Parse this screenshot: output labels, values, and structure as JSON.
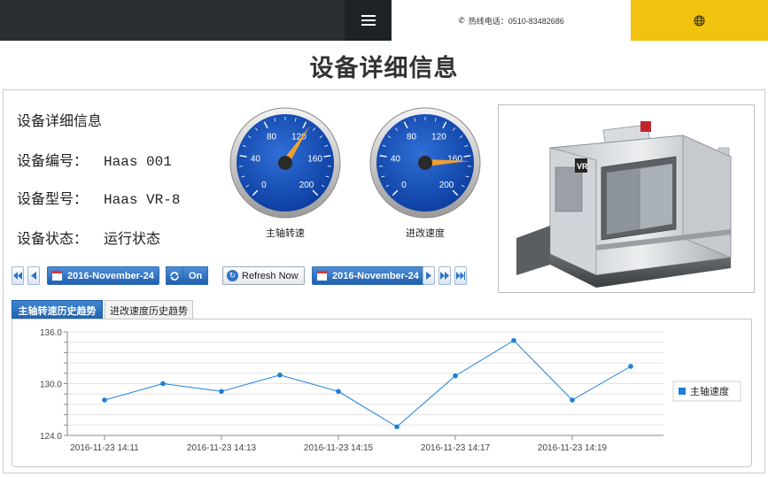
{
  "header": {
    "hotline_text": "热线电话：0510-83482686",
    "menu_icon": "hamburger-menu-icon",
    "phone_icon": "phone-icon",
    "globe_icon": "globe-icon",
    "accent_color": "#f1c30f"
  },
  "page": {
    "title": "设备详细信息"
  },
  "device": {
    "heading": "设备详细信息",
    "number_label": "设备编号：",
    "number_value": "Haas 001",
    "model_label": "设备型号：",
    "model_value": "Haas VR-8",
    "status_label": "设备状态：",
    "status_value": "运行状态"
  },
  "gauges": [
    {
      "label": "主轴转速",
      "ticks": [
        "0",
        "40",
        "80",
        "120",
        "160",
        "200"
      ],
      "min": 0,
      "max": 200,
      "value": 125
    },
    {
      "label": "进改速度",
      "ticks": [
        "0",
        "40",
        "80",
        "120",
        "160",
        "200"
      ],
      "min": 0,
      "max": 200,
      "value": 165
    }
  ],
  "toolbar": {
    "start_date": "2016-November-24",
    "on_label": "On",
    "refresh_label": "Refresh Now",
    "end_date": "2016-November-24"
  },
  "tabs": [
    {
      "label": "主轴转速历史趋势",
      "active": true
    },
    {
      "label": "进改速度历史趋势",
      "active": false
    }
  ],
  "chart_data": {
    "type": "line",
    "x": [
      "2016-11-23 14:11",
      "2016-11-23 14:12",
      "2016-11-23 14:13",
      "2016-11-23 14:14",
      "2016-11-23 14:15",
      "2016-11-23 14:16",
      "2016-11-23 14:17",
      "2016-11-23 14:18",
      "2016-11-23 14:19",
      "2016-11-23 14:20"
    ],
    "x_tick_labels": [
      "2016-11-23 14:11",
      "2016-11-23 14:13",
      "2016-11-23 14:15",
      "2016-11-23 14:17",
      "2016-11-23 14:19"
    ],
    "series": [
      {
        "name": "主轴速度",
        "values": [
          128.1,
          130.0,
          129.1,
          131.0,
          129.1,
          125.0,
          130.9,
          135.0,
          128.1,
          132.0
        ]
      }
    ],
    "y_ticks": [
      "124.0",
      "130.0",
      "136.0"
    ],
    "ylim": [
      124,
      136
    ],
    "grid": true,
    "legend": "right",
    "line_color": "#1e7fd6"
  }
}
